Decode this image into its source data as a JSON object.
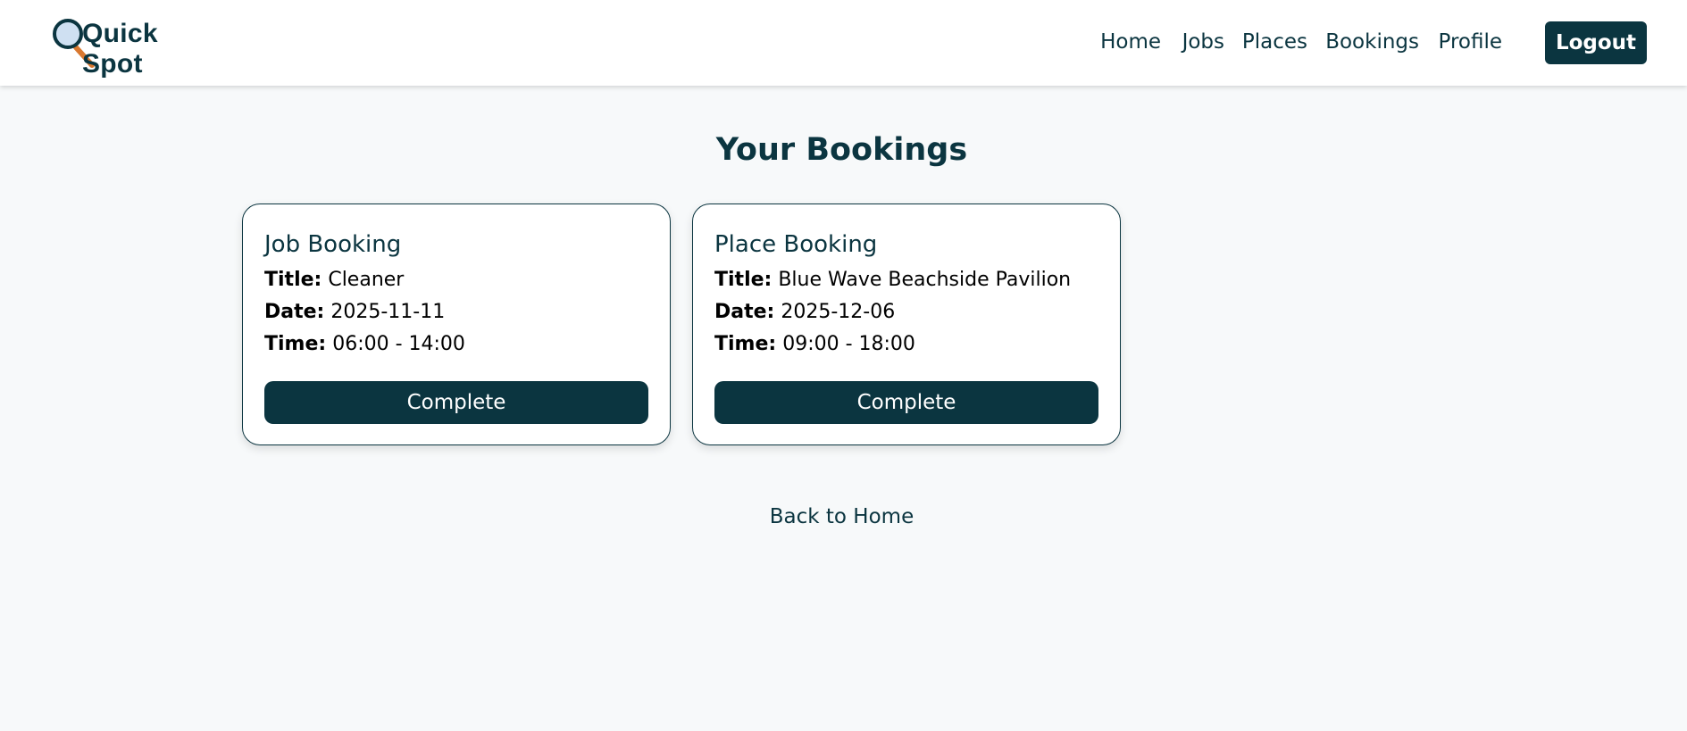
{
  "brand": {
    "name": "Quick Spot"
  },
  "nav": {
    "items": [
      {
        "label": "Home"
      },
      {
        "label": "Jobs"
      },
      {
        "label": "Places"
      },
      {
        "label": "Bookings"
      },
      {
        "label": "Profile"
      }
    ],
    "logout_label": "Logout"
  },
  "page": {
    "title": "Your Bookings",
    "back_link": "Back to Home"
  },
  "bookings": [
    {
      "heading": "Job Booking",
      "title_label": "Title:",
      "title": "Cleaner",
      "date_label": "Date:",
      "date": "2025-11-11",
      "time_label": "Time:",
      "time": "06:00 - 14:00",
      "action_label": "Complete"
    },
    {
      "heading": "Place Booking",
      "title_label": "Title:",
      "title": "Blue Wave Beachside Pavilion",
      "date_label": "Date:",
      "date": "2025-12-06",
      "time_label": "Time:",
      "time": "09:00 - 18:00",
      "action_label": "Complete"
    }
  ],
  "colors": {
    "primary": "#0b3540",
    "background": "#f7f9fa",
    "card_background": "#ffffff",
    "logo_handle": "#d9782f",
    "logo_lens": "#cfe0f2"
  }
}
